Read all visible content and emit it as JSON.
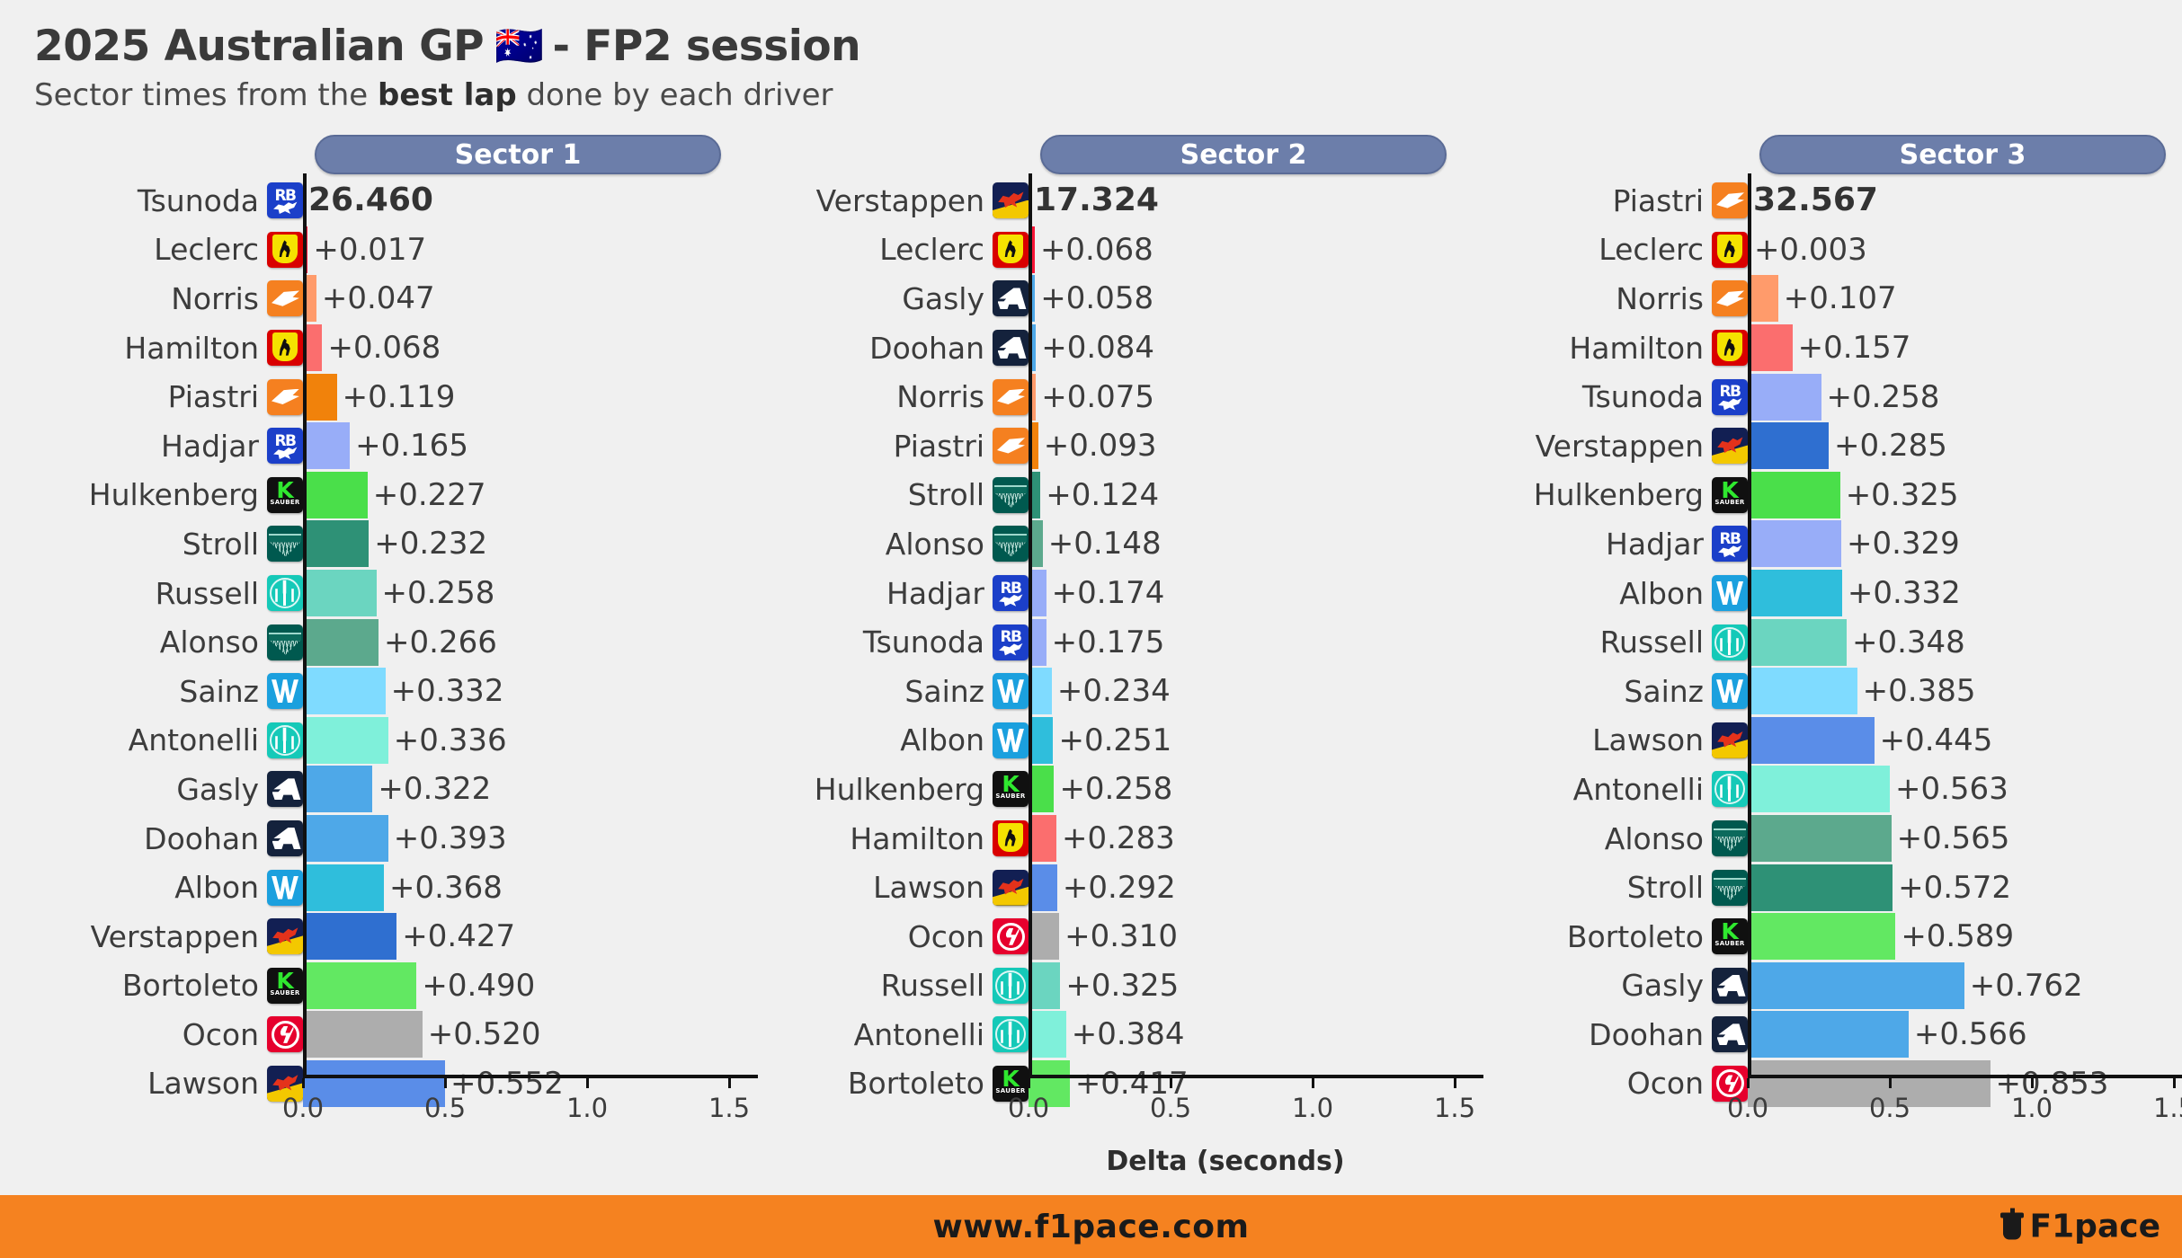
{
  "header": {
    "title_pre": "2025 Australian GP",
    "flag": "🇦🇺",
    "title_post": "- FP2 session",
    "subtitle_pre": "Sector times from the ",
    "subtitle_bold": "best lap",
    "subtitle_post": " done by each driver"
  },
  "footer": {
    "url": "www.f1pace.com",
    "brand": "F1pace"
  },
  "axis": {
    "xlabel": "Delta (seconds)",
    "ticks": [
      "0.0",
      "0.5",
      "1.0",
      "1.5"
    ],
    "tick_values": [
      0.0,
      0.5,
      1.0,
      1.5
    ],
    "xlim": [
      0.0,
      1.6
    ]
  },
  "team_colors": {
    "mclaren_p": "#F1820B",
    "mclaren_n": "#FF9B6B",
    "ferrari_l": "#F81536",
    "ferrari_h": "#FB6E6E",
    "redbull_v": "#2F6FD0",
    "redbull_l": "#5A8DE8",
    "rb_ts": "#98ADF8",
    "rb_hj": "#98ADF8",
    "mercedes_r": "#6BD5C0",
    "mercedes_a": "#7FF0DA",
    "aston_s": "#2E9176",
    "aston_al": "#5CA98D",
    "williams_s": "#7FDBFF",
    "williams_al": "#2FBEDC",
    "alpine": "#4EA8E8",
    "sauber_h": "#4ADF4A",
    "sauber_b": "#62E862",
    "haas": "#ADADAD",
    "pill": "#6C7EAA",
    "footer_bg": "#F58220",
    "page_bg": "#F0F0F0"
  },
  "chart_data": {
    "type": "bar",
    "title": "2025 Australian GP - FP2 session",
    "subtitle": "Sector times from the best lap done by each driver",
    "xlabel": "Delta (seconds)",
    "ylabel": "",
    "xlim": [
      0.0,
      1.6
    ],
    "grid": false,
    "legend": "none",
    "panels": [
      {
        "name": "Sector 1",
        "leader_time": "26.460",
        "categories": [
          "Tsunoda",
          "Leclerc",
          "Norris",
          "Hamilton",
          "Piastri",
          "Hadjar",
          "Hulkenberg",
          "Stroll",
          "Russell",
          "Alonso",
          "Sainz",
          "Antonelli",
          "Gasly",
          "Doohan",
          "Albon",
          "Verstappen",
          "Bortoleto",
          "Ocon",
          "Lawson"
        ],
        "labels": [
          "26.460",
          "+0.017",
          "+0.047",
          "+0.068",
          "+0.119",
          "+0.165",
          "+0.227",
          "+0.232",
          "+0.258",
          "+0.266",
          "+0.332",
          "+0.336",
          "+0.322",
          "+0.393",
          "+0.368",
          "+0.427",
          "+0.490",
          "+0.520",
          "+0.552"
        ],
        "values": [
          0.0,
          0.017,
          0.047,
          0.068,
          0.119,
          0.165,
          0.227,
          0.232,
          0.258,
          0.266,
          0.332,
          0.336,
          0.322,
          0.393,
          0.368,
          0.427,
          0.49,
          0.52,
          0.552
        ],
        "bar_values": [
          0.0,
          0.017,
          0.047,
          0.068,
          0.119,
          0.165,
          0.227,
          0.232,
          0.258,
          0.266,
          0.29,
          0.3,
          0.245,
          0.3,
          0.285,
          0.33,
          0.4,
          0.42,
          0.5
        ],
        "teams": [
          "rb",
          "ferrari",
          "mclaren",
          "ferrari",
          "mclaren",
          "rb",
          "sauber",
          "aston",
          "mercedes",
          "aston",
          "williams",
          "mercedes",
          "alpine",
          "alpine",
          "williams",
          "redbull",
          "sauber",
          "haas",
          "redbull"
        ],
        "colors": [
          "#98ADF8",
          "#F81536",
          "#FF9B6B",
          "#FB6E6E",
          "#F1820B",
          "#98ADF8",
          "#4ADF4A",
          "#2E9176",
          "#6BD5C0",
          "#5CA98D",
          "#7FDBFF",
          "#7FF0DA",
          "#4EA8E8",
          "#4EA8E8",
          "#2FBEDC",
          "#2F6FD0",
          "#62E862",
          "#ADADAD",
          "#5A8DE8"
        ]
      },
      {
        "name": "Sector 2",
        "leader_time": "17.324",
        "categories": [
          "Verstappen",
          "Leclerc",
          "Gasly",
          "Doohan",
          "Norris",
          "Piastri",
          "Stroll",
          "Alonso",
          "Hadjar",
          "Tsunoda",
          "Sainz",
          "Albon",
          "Hulkenberg",
          "Hamilton",
          "Lawson",
          "Ocon",
          "Russell",
          "Antonelli",
          "Bortoleto"
        ],
        "labels": [
          "17.324",
          "+0.068",
          "+0.058",
          "+0.084",
          "+0.075",
          "+0.093",
          "+0.124",
          "+0.148",
          "+0.174",
          "+0.175",
          "+0.234",
          "+0.251",
          "+0.258",
          "+0.283",
          "+0.292",
          "+0.310",
          "+0.325",
          "+0.384",
          "+0.417"
        ],
        "values": [
          0.0,
          0.068,
          0.058,
          0.084,
          0.075,
          0.093,
          0.124,
          0.148,
          0.174,
          0.175,
          0.234,
          0.251,
          0.258,
          0.283,
          0.292,
          0.31,
          0.325,
          0.384,
          0.417
        ],
        "bar_values": [
          0.0,
          0.022,
          0.023,
          0.026,
          0.026,
          0.034,
          0.042,
          0.05,
          0.062,
          0.062,
          0.082,
          0.087,
          0.09,
          0.098,
          0.101,
          0.108,
          0.112,
          0.132,
          0.145
        ],
        "teams": [
          "redbull",
          "ferrari",
          "alpine",
          "alpine",
          "mclaren",
          "mclaren",
          "aston",
          "aston",
          "rb",
          "rb",
          "williams",
          "williams",
          "sauber",
          "ferrari",
          "redbull",
          "haas",
          "mercedes",
          "mercedes",
          "sauber"
        ],
        "colors": [
          "#2F6FD0",
          "#F81536",
          "#4EA8E8",
          "#4EA8E8",
          "#FF9B6B",
          "#F1820B",
          "#2E9176",
          "#5CA98D",
          "#98ADF8",
          "#98ADF8",
          "#7FDBFF",
          "#2FBEDC",
          "#4ADF4A",
          "#FB6E6E",
          "#5A8DE8",
          "#ADADAD",
          "#6BD5C0",
          "#7FF0DA",
          "#62E862"
        ]
      },
      {
        "name": "Sector 3",
        "leader_time": "32.567",
        "categories": [
          "Piastri",
          "Leclerc",
          "Norris",
          "Hamilton",
          "Tsunoda",
          "Verstappen",
          "Hulkenberg",
          "Hadjar",
          "Albon",
          "Russell",
          "Sainz",
          "Lawson",
          "Antonelli",
          "Alonso",
          "Stroll",
          "Bortoleto",
          "Gasly",
          "Doohan",
          "Ocon"
        ],
        "labels": [
          "32.567",
          "+0.003",
          "+0.107",
          "+0.157",
          "+0.258",
          "+0.285",
          "+0.325",
          "+0.329",
          "+0.332",
          "+0.348",
          "+0.385",
          "+0.445",
          "+0.563",
          "+0.565",
          "+0.572",
          "+0.589",
          "+0.762",
          "+0.566",
          "+0.853"
        ],
        "values": [
          0.0,
          0.003,
          0.107,
          0.157,
          0.258,
          0.285,
          0.325,
          0.329,
          0.332,
          0.348,
          0.385,
          0.445,
          0.563,
          0.565,
          0.572,
          0.589,
          0.762,
          0.566,
          0.853
        ],
        "bar_values": [
          0.0,
          0.003,
          0.107,
          0.157,
          0.258,
          0.285,
          0.325,
          0.329,
          0.332,
          0.348,
          0.385,
          0.445,
          0.5,
          0.505,
          0.51,
          0.52,
          0.762,
          0.566,
          0.853
        ],
        "teams": [
          "mclaren",
          "ferrari",
          "mclaren",
          "ferrari",
          "rb",
          "redbull",
          "sauber",
          "rb",
          "williams",
          "mercedes",
          "williams",
          "redbull",
          "mercedes",
          "aston",
          "aston",
          "sauber",
          "alpine",
          "alpine",
          "haas"
        ],
        "colors": [
          "#F1820B",
          "#F81536",
          "#FF9B6B",
          "#FB6E6E",
          "#98ADF8",
          "#2F6FD0",
          "#4ADF4A",
          "#98ADF8",
          "#2FBEDC",
          "#6BD5C0",
          "#7FDBFF",
          "#5A8DE8",
          "#7FF0DA",
          "#5CA98D",
          "#2E9176",
          "#62E862",
          "#4EA8E8",
          "#4EA8E8",
          "#ADADAD"
        ]
      }
    ]
  }
}
